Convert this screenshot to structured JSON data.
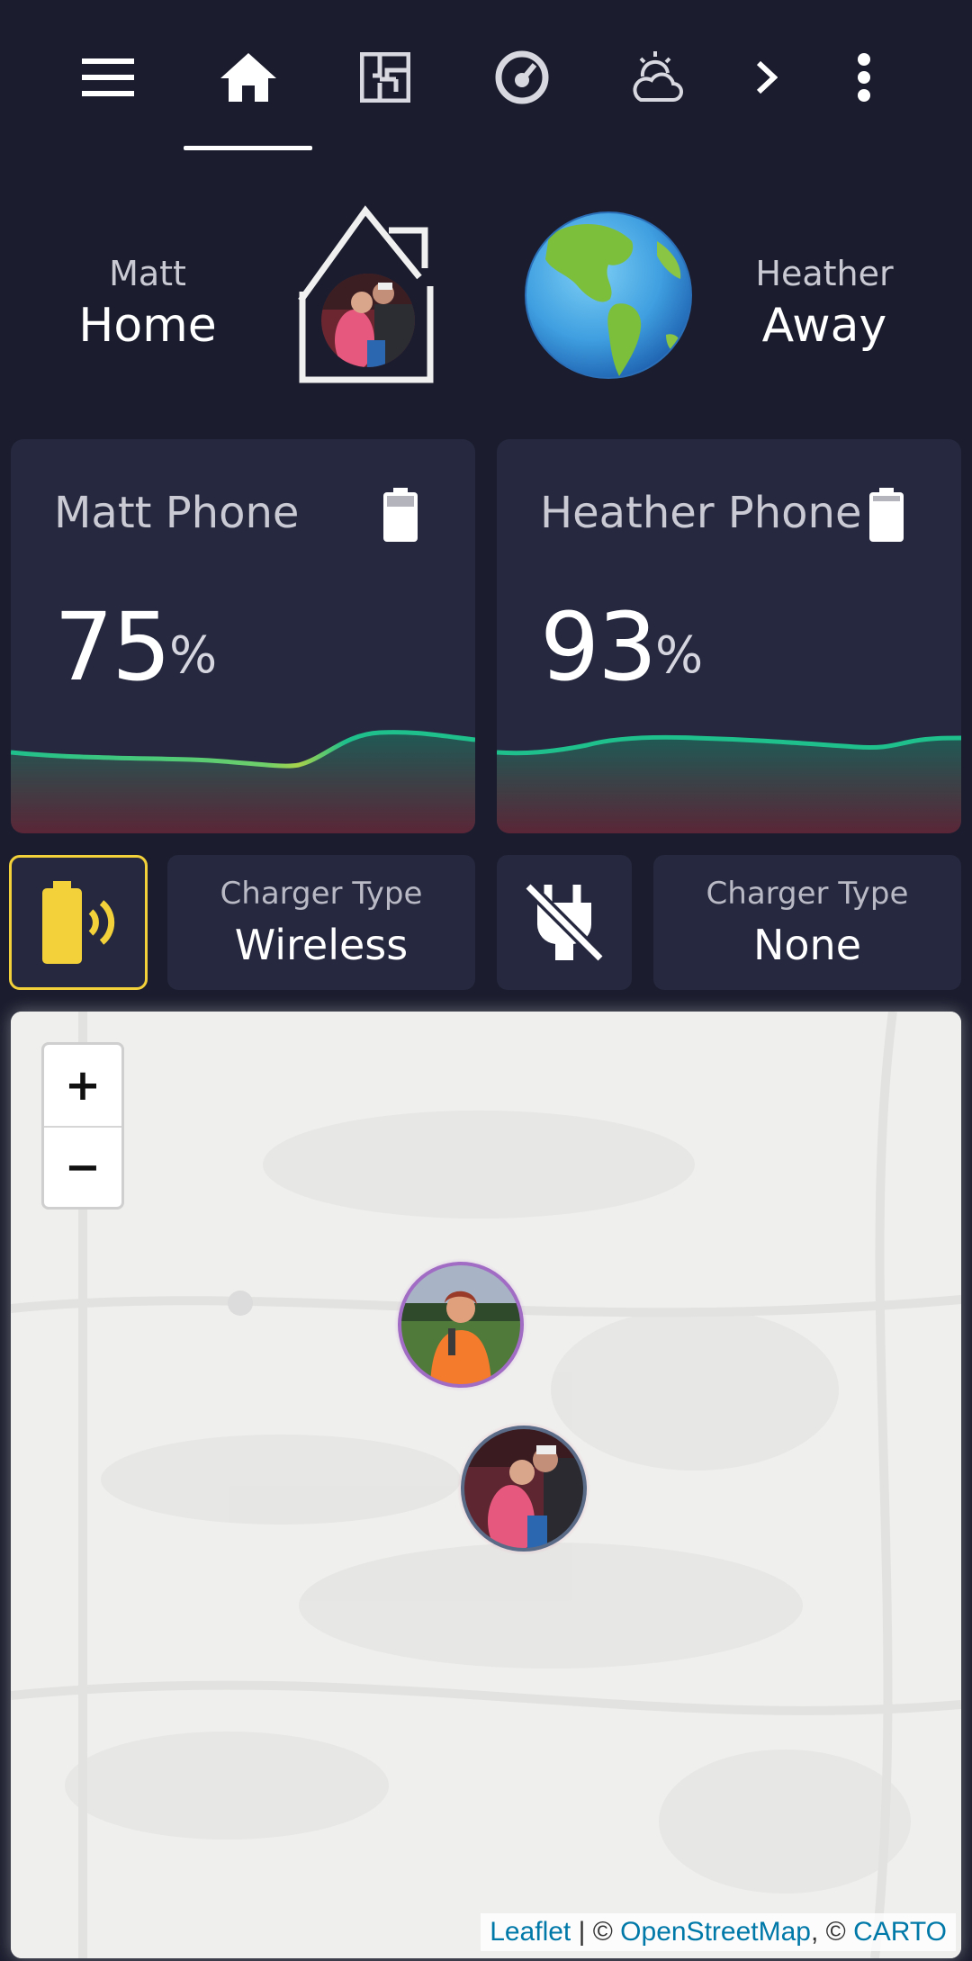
{
  "nav": {
    "icons": [
      "menu-icon",
      "home-icon",
      "floorplan-icon",
      "gauge-icon",
      "weather-icon",
      "chevron-right-icon",
      "more-vert-icon"
    ],
    "active_index": 1
  },
  "persons": [
    {
      "name": "Matt",
      "state": "Home"
    },
    {
      "name": "Heather",
      "state": "Away"
    }
  ],
  "battery_cards": [
    {
      "title": "Matt Phone",
      "value": "75",
      "unit": "%",
      "level": 0.75
    },
    {
      "title": "Heather Phone",
      "value": "93",
      "unit": "%",
      "level": 0.93
    }
  ],
  "chargers": [
    {
      "icon": "battery-charging-wireless-icon",
      "active": true,
      "label": "Charger Type",
      "value": "Wireless",
      "accent": "#f2d13a"
    },
    {
      "icon": "power-plug-off-icon",
      "active": false,
      "label": "Charger Type",
      "value": "None"
    }
  ],
  "map": {
    "zoom_in": "+",
    "zoom_out": "−",
    "attribution": {
      "leaflet": "Leaflet",
      "sep1": " | © ",
      "osm": "OpenStreetMap",
      "sep2": ", © ",
      "carto": "CARTO"
    }
  },
  "colors": {
    "background": "#1b1d2e",
    "card": "#25283e",
    "spark_line": "#1fc08c",
    "accent_yellow": "#f2d13a"
  }
}
